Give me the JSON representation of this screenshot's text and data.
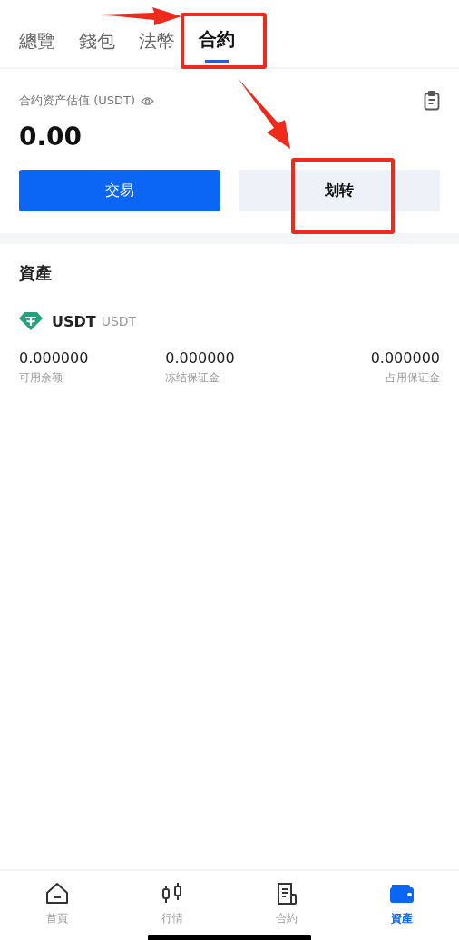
{
  "tabs": [
    {
      "label": "總覽",
      "selected": false
    },
    {
      "label": "錢包",
      "selected": false
    },
    {
      "label": "法幣",
      "selected": false
    },
    {
      "label": "合約",
      "selected": true
    }
  ],
  "summary": {
    "label": "合约资产估值 (USDT)",
    "value": "0.00"
  },
  "buttons": [
    {
      "label": "交易",
      "kind": "primary"
    },
    {
      "label": "划转",
      "kind": "secondary"
    }
  ],
  "assets": {
    "title": "資產",
    "coin": {
      "symbol": "USDT",
      "name": "USDT"
    },
    "stats": [
      {
        "value": "0.000000",
        "label": "可用余额"
      },
      {
        "value": "0.000000",
        "label": "冻结保证金"
      },
      {
        "value": "0.000000",
        "label": "占用保证金"
      }
    ]
  },
  "bottom_nav": [
    {
      "label": "首頁",
      "selected": false
    },
    {
      "label": "行情",
      "selected": false
    },
    {
      "label": "合約",
      "selected": false
    },
    {
      "label": "資產",
      "selected": true
    }
  ]
}
